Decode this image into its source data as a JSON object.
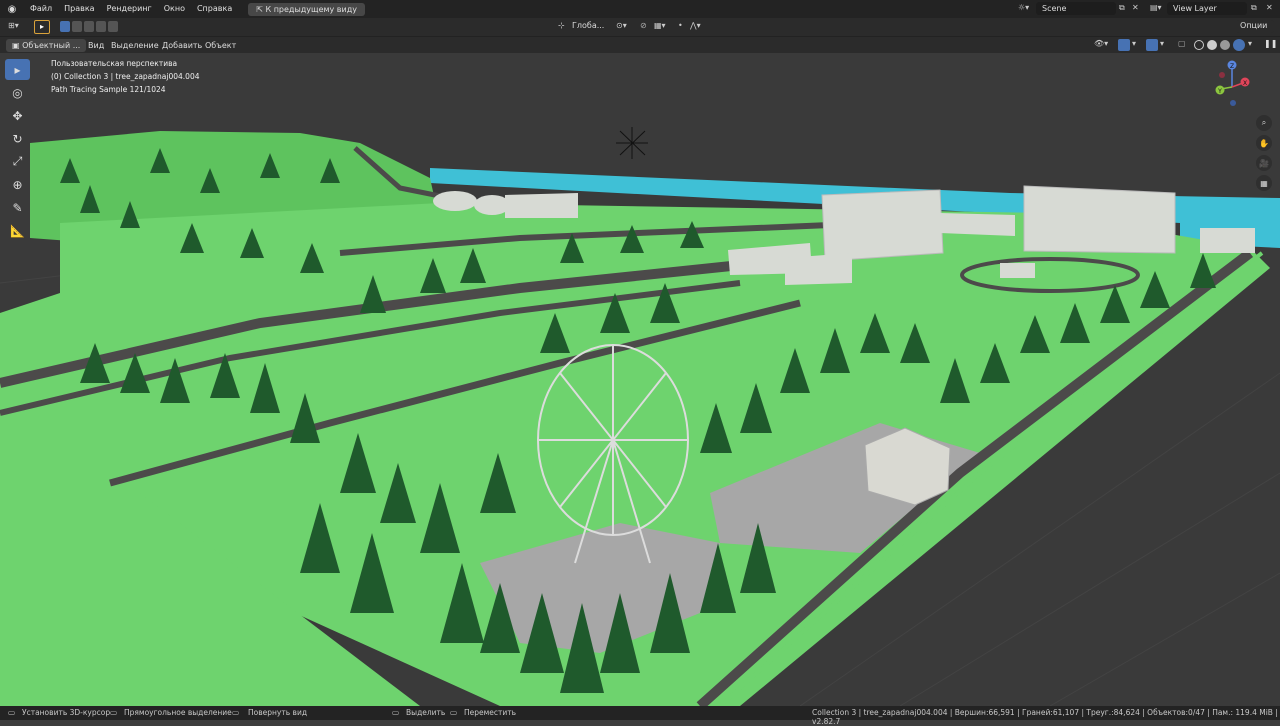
{
  "topbar": {
    "menus": [
      "Файл",
      "Правка",
      "Рендеринг",
      "Окно",
      "Справка"
    ],
    "back_button": "К предыдущему виду",
    "scene": "Scene",
    "view_layer": "View Layer"
  },
  "header": {
    "transform_orientation": "Глоба...",
    "options": "Опции"
  },
  "viewport_header": {
    "mode": "Объектный ...",
    "menus": [
      "Вид",
      "Выделение",
      "Добавить",
      "Объект"
    ]
  },
  "viewport": {
    "perspective": "Пользовательская перспектива",
    "collection": "(0) Collection 3 | tree_zapadnaj004.004",
    "samples": "Path Tracing Sample 121/1024"
  },
  "gizmo": {
    "z": "Z",
    "y": "Y",
    "x": "X"
  },
  "statusbar": {
    "hint1": "Установить 3D-курсор",
    "hint2": "Прямоугольное выделение",
    "hint3": "Повернуть вид",
    "hint4": "Выделить",
    "hint5": "Переместить",
    "stats": "Collection 3 | tree_zapadnaj004.004 | Вершин:66,591 | Граней:61,107 | Треуг.:84,624 | Объектов:0/47 | Пам.: 119.4 MiB | v2.82.7"
  },
  "colors": {
    "grass": "#6ed36e",
    "water": "#3fc0d6",
    "tree": "#1f5a2c",
    "building": "#d7dad4",
    "road": "#4c4a4a"
  }
}
